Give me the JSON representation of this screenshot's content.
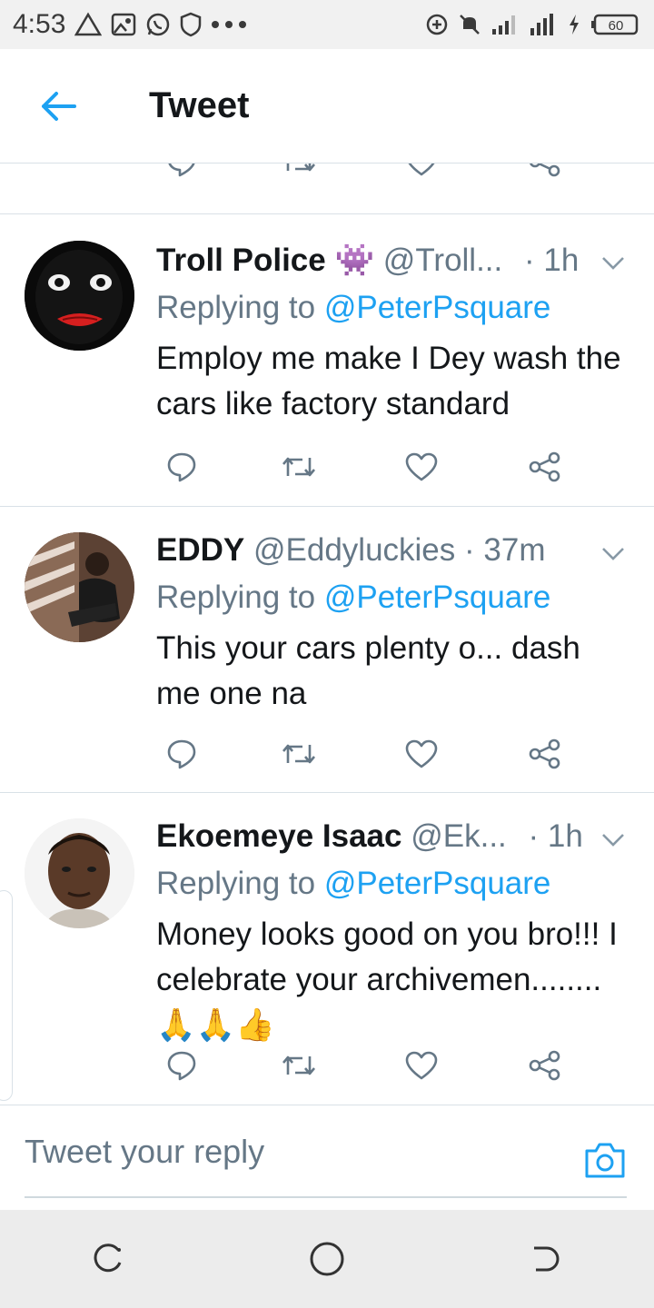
{
  "status_bar": {
    "time": "4:53",
    "battery": "60",
    "left_icons": [
      "warning-icon",
      "image-icon",
      "whatsapp-icon",
      "shield-icon",
      "more-dots-icon"
    ],
    "right_icons": [
      "data-saver-icon",
      "mute-icon",
      "signal-icon",
      "signal-4g-icon",
      "charging-icon",
      "battery-icon"
    ]
  },
  "app_bar": {
    "title": "Tweet"
  },
  "tweets": [
    {
      "name": "Troll Police",
      "name_emoji": "👾",
      "handle": "@Troll...",
      "time": "· 1h",
      "replying_prefix": "Replying to",
      "replying_handle": "@PeterPsquare",
      "text": "Employ me make I Dey wash the cars like factory standard"
    },
    {
      "name": "EDDY",
      "handle": "@Eddyluckies",
      "time": "· 37m",
      "replying_prefix": "Replying to",
      "replying_handle": "@PeterPsquare",
      "text": "This your cars plenty o... dash me one na"
    },
    {
      "name": "Ekoemeye Isaac",
      "handle": "@Ek...",
      "time": "· 1h",
      "replying_prefix": "Replying to",
      "replying_handle": "@PeterPsquare",
      "text": "Money looks good on you bro!!! I celebrate your archivemen........",
      "text_emojis": "🙏🙏👍"
    }
  ],
  "reply_bar": {
    "placeholder": "Tweet your reply"
  },
  "colors": {
    "accent": "#1da1f2",
    "secondary_text": "#657786",
    "primary_text": "#14171a",
    "divider": "#d9e1e7"
  }
}
